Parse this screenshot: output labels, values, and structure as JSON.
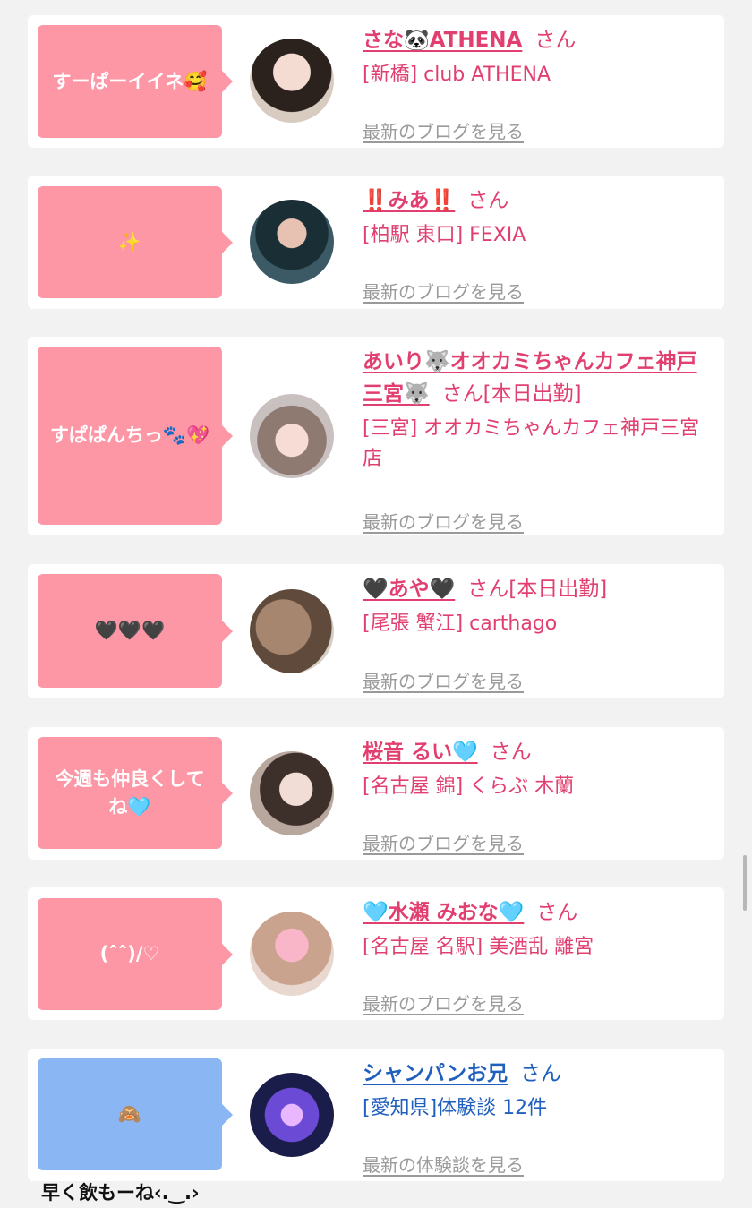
{
  "san_label": "さん",
  "posts": [
    {
      "bubble_text": "すーぱーイイネ🥰",
      "bubble_color": "#fd97a6",
      "name": "さな🐼ATHENA",
      "extra": "",
      "shop": "[新橋] club ATHENA",
      "blog_link": "最新のブログを見る",
      "avatar_icon": "avatar-photo"
    },
    {
      "bubble_text": "✨",
      "bubble_color": "#fd97a6",
      "name": "‼️みあ‼️",
      "extra": "",
      "shop": "[柏駅 東口] FEXIA",
      "blog_link": "最新のブログを見る",
      "avatar_icon": "avatar-photo"
    },
    {
      "bubble_text": "すぱぱんちっ🐾💖",
      "bubble_color": "#fd97a6",
      "name": "あいり🐺オオカミちゃんカフェ神戸三宮🐺",
      "extra": "[本日出勤]",
      "shop": "[三宮] オオカミちゃんカフェ神戸三宮店",
      "blog_link": "最新のブログを見る",
      "avatar_icon": "avatar-photo"
    },
    {
      "bubble_text": "🖤🖤🖤",
      "bubble_color": "#fd97a6",
      "name": "🖤あや🖤",
      "extra": "[本日出勤]",
      "shop": "[尾張 蟹江] carthago",
      "blog_link": "最新のブログを見る",
      "avatar_icon": "avatar-photo"
    },
    {
      "bubble_text": "今週も仲良くしてね🩵",
      "bubble_color": "#fd97a6",
      "name": "桜音 るい🩵",
      "extra": "",
      "shop": "[名古屋 錦] くらぶ 木蘭",
      "blog_link": "最新のブログを見る",
      "avatar_icon": "avatar-photo"
    },
    {
      "bubble_text": "(ˆˆ)/♡",
      "bubble_color": "#fd97a6",
      "name": "🩵水瀬 みおな🩵",
      "extra": "",
      "shop": "[名古屋 名駅] 美酒乱 離宮",
      "blog_link": "最新のブログを見る",
      "avatar_icon": "avatar-photo"
    },
    {
      "bubble_text": "🙈",
      "bubble_color": "#8ab6f4",
      "name": "シャンパンお兄",
      "extra": "",
      "shop": "[愛知県]体験談 12件",
      "blog_link": "最新の体験談を見る",
      "avatar_icon": "avatar-photo"
    }
  ],
  "caption": "早く飲もーね‹.‿.›"
}
